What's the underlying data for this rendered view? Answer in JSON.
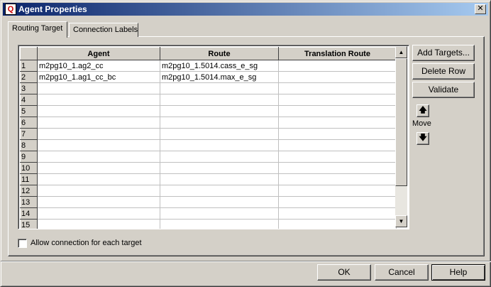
{
  "window": {
    "title": "Agent Properties",
    "close_glyph": "✕"
  },
  "tabs": [
    {
      "label": "Routing Target",
      "active": true
    },
    {
      "label": "Connection Labels",
      "active": false
    }
  ],
  "grid": {
    "columns": [
      "Agent",
      "Route",
      "Translation Route"
    ],
    "rows": [
      {
        "num": "1",
        "agent": "m2pg10_1.ag2_cc",
        "route": "m2pg10_1.5014.cass_e_sg",
        "translation": ""
      },
      {
        "num": "2",
        "agent": "m2pg10_1.ag1_cc_bc",
        "route": "m2pg10_1.5014.max_e_sg",
        "translation": ""
      },
      {
        "num": "3",
        "agent": "",
        "route": "",
        "translation": ""
      },
      {
        "num": "4",
        "agent": "",
        "route": "",
        "translation": ""
      },
      {
        "num": "5",
        "agent": "",
        "route": "",
        "translation": ""
      },
      {
        "num": "6",
        "agent": "",
        "route": "",
        "translation": ""
      },
      {
        "num": "7",
        "agent": "",
        "route": "",
        "translation": ""
      },
      {
        "num": "8",
        "agent": "",
        "route": "",
        "translation": ""
      },
      {
        "num": "9",
        "agent": "",
        "route": "",
        "translation": ""
      },
      {
        "num": "10",
        "agent": "",
        "route": "",
        "translation": ""
      },
      {
        "num": "11",
        "agent": "",
        "route": "",
        "translation": ""
      },
      {
        "num": "12",
        "agent": "",
        "route": "",
        "translation": ""
      },
      {
        "num": "13",
        "agent": "",
        "route": "",
        "translation": ""
      },
      {
        "num": "14",
        "agent": "",
        "route": "",
        "translation": ""
      },
      {
        "num": "15",
        "agent": "",
        "route": "",
        "translation": ""
      }
    ]
  },
  "side_buttons": {
    "add_targets": "Add Targets...",
    "delete_row": "Delete Row",
    "validate": "Validate"
  },
  "move": {
    "label": "Move",
    "up_glyph": "🡅",
    "down_glyph": "🡇"
  },
  "checkbox": {
    "label": "Allow connection for each target",
    "checked": false
  },
  "footer": {
    "ok": "OK",
    "cancel": "Cancel",
    "help": "Help"
  }
}
